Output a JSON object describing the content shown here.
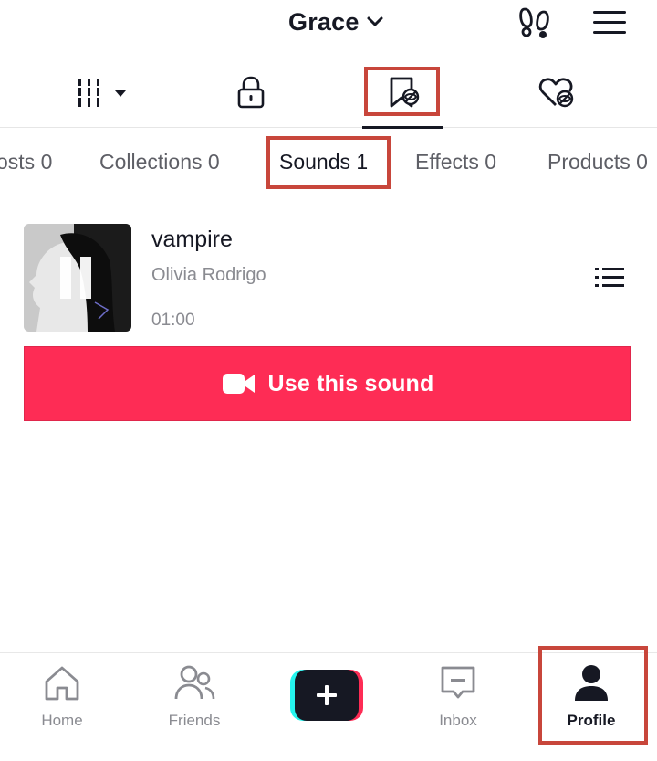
{
  "header": {
    "username": "Grace",
    "icons": {
      "switch": "chevron-down-icon",
      "footprint": "footprint-icon",
      "menu": "hamburger-menu-icon"
    }
  },
  "icon_tabs": [
    {
      "name": "videos-grid",
      "icon": "grid-icon"
    },
    {
      "name": "private",
      "icon": "lock-icon"
    },
    {
      "name": "favorites",
      "icon": "bookmark-hidden-icon",
      "active": true
    },
    {
      "name": "liked",
      "icon": "heart-hidden-icon"
    }
  ],
  "text_tabs": [
    {
      "label": "osts 0"
    },
    {
      "label": "Collections 0"
    },
    {
      "label": "Sounds 1",
      "active": true
    },
    {
      "label": "Effects 0"
    },
    {
      "label": "Products 0"
    }
  ],
  "sound": {
    "title": "vampire",
    "artist": "Olivia Rodrigo",
    "duration": "01:00",
    "state_icon": "pause-icon",
    "use_label": "Use this sound"
  },
  "bottom_nav": {
    "items": [
      {
        "label": "Home",
        "icon": "home-icon"
      },
      {
        "label": "Friends",
        "icon": "friends-icon"
      },
      {
        "label": "",
        "icon": "create-plus-icon"
      },
      {
        "label": "Inbox",
        "icon": "inbox-icon"
      },
      {
        "label": "Profile",
        "icon": "profile-icon",
        "active": true
      }
    ]
  },
  "colors": {
    "accent": "#fe2c55",
    "highlight_box": "#c8463b",
    "text_primary": "#161823",
    "text_secondary": "#8a8b91",
    "create_cyan": "#25f4ee"
  }
}
